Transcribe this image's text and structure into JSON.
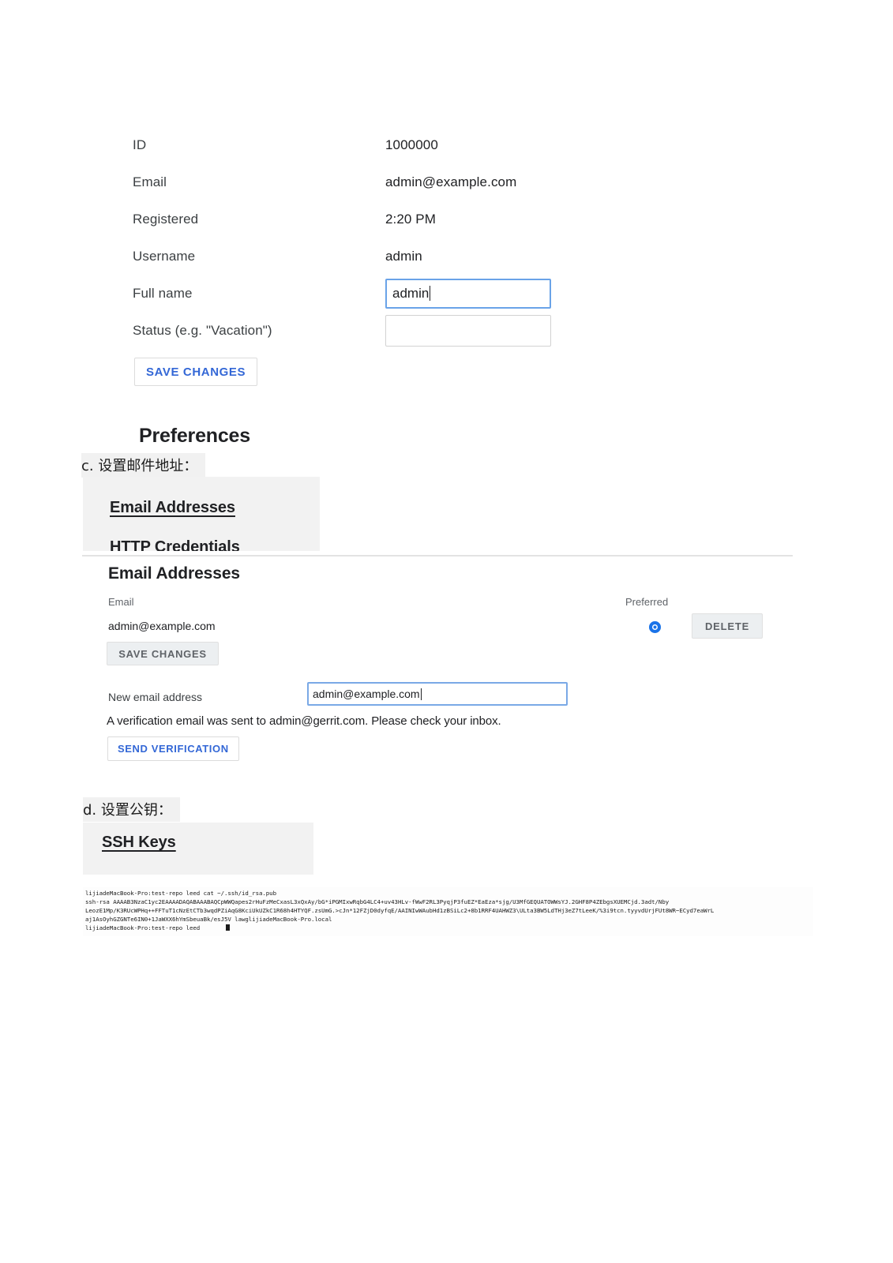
{
  "document": {
    "profile": {
      "fields": [
        {
          "label": "ID",
          "value": "1000000"
        },
        {
          "label": "Email",
          "value": "admin@example.com"
        },
        {
          "label": "Registered",
          "value": "2:20 PM"
        },
        {
          "label": "Username",
          "value": "admin"
        }
      ],
      "full_name_label": "Full name",
      "full_name_value": "admin",
      "status_label": "Status (e.g. \"Vacation\")",
      "status_value": "",
      "save_changes_label": "SAVE CHANGES",
      "preferences_heading": "Preferences"
    },
    "captions": {
      "c": "c. 设置邮件地址：",
      "d": "d. 设置公钥："
    },
    "nav_crop": {
      "email_addresses_link": "Email Addresses",
      "http_credentials_link": "HTTP Credentials"
    },
    "email_panel": {
      "title": "Email Addresses",
      "col_email": "Email",
      "col_preferred": "Preferred",
      "email_value": "admin@example.com",
      "delete_label": "DELETE",
      "save_changes_label": "SAVE CHANGES",
      "new_email_label": "New email address",
      "new_email_value": "admin@example.com",
      "verification_note": "A verification email was sent to admin@gerrit.com. Please check your inbox.",
      "send_verification_label": "SEND VERIFICATION"
    },
    "ssh_crop": {
      "ssh_keys_link": "SSH Keys"
    },
    "terminal": {
      "lines": [
        "lijiadeMacBook-Pro:test-repo leed cat ~/.ssh/id_rsa.pub",
        "ssh-rsa AAAAB3NzaC1yc2EAAAADAQABAAABAQCpWWQapes2rHuFzMeCxasL3xQxAy/bG*iPGMIxwRqbG4LC4+uv43HLv-fWwF2RL3PyqjP3fuEZ*EaEza*sjg/U3MfGEQUATOWWsYJ.2GHF8P4ZEbgsXUEMCjd.3adt/Nby",
        "LeozE1Mp/K3RUcWPHq++FFTuT1cNzEtCTb3wqdPZiAqG8KciUkUZkC1R68h4HTYQF.zsUmG.>cJn*12FZjD0dyfqE/AAINIwWAubHd1zBSiLc2+8b1RRF4UAHWZ3\\ULta3BW5LdTHj3eZ7tLeeK/%3i9tcn.tyyvdUrjFUt8WR~ECyd7eaWrL",
        "aj1AsOyhGZGNTe6IN0+1JaWXX6hYmSbeuaBk/esJ5V lawglijiadeMacBook-Pro.local",
        "lijiadeMacBook-Pro:test-repo leed "
      ]
    }
  }
}
